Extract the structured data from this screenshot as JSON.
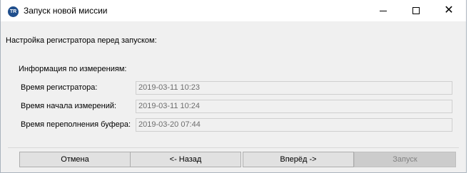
{
  "window": {
    "title": "Запуск новой миссии",
    "icon_text": "TR",
    "icon": "app-logo-icon",
    "controls": [
      "minimize-icon",
      "maximize-icon",
      "close-icon"
    ],
    "close_glyph": "✕"
  },
  "header": {
    "subtitle": "Настройка регистратора перед запуском:"
  },
  "measurement_info": {
    "title": "Информация по измерениям:",
    "rows": [
      {
        "label": "Время регистратора:",
        "value": "2019-03-11 10:23"
      },
      {
        "label": "Время начала измерений:",
        "value": "2019-03-11 10:24"
      },
      {
        "label": "Время переполнения буфера:",
        "value": "2019-03-20 07:44"
      }
    ]
  },
  "buttons": {
    "cancel": "Отмена",
    "back": "<- Назад",
    "next": "Вперёд ->",
    "start": "Запуск",
    "start_enabled": false
  },
  "colors": {
    "dialog_bg": "#f0f0f0",
    "titlebar_bg": "#ffffff",
    "button_bg": "#e1e1e1",
    "disabled_button_bg": "#cccccc",
    "disabled_text": "#838383",
    "field_text": "#6d6d6d",
    "app_icon": "#1f4e8c"
  }
}
